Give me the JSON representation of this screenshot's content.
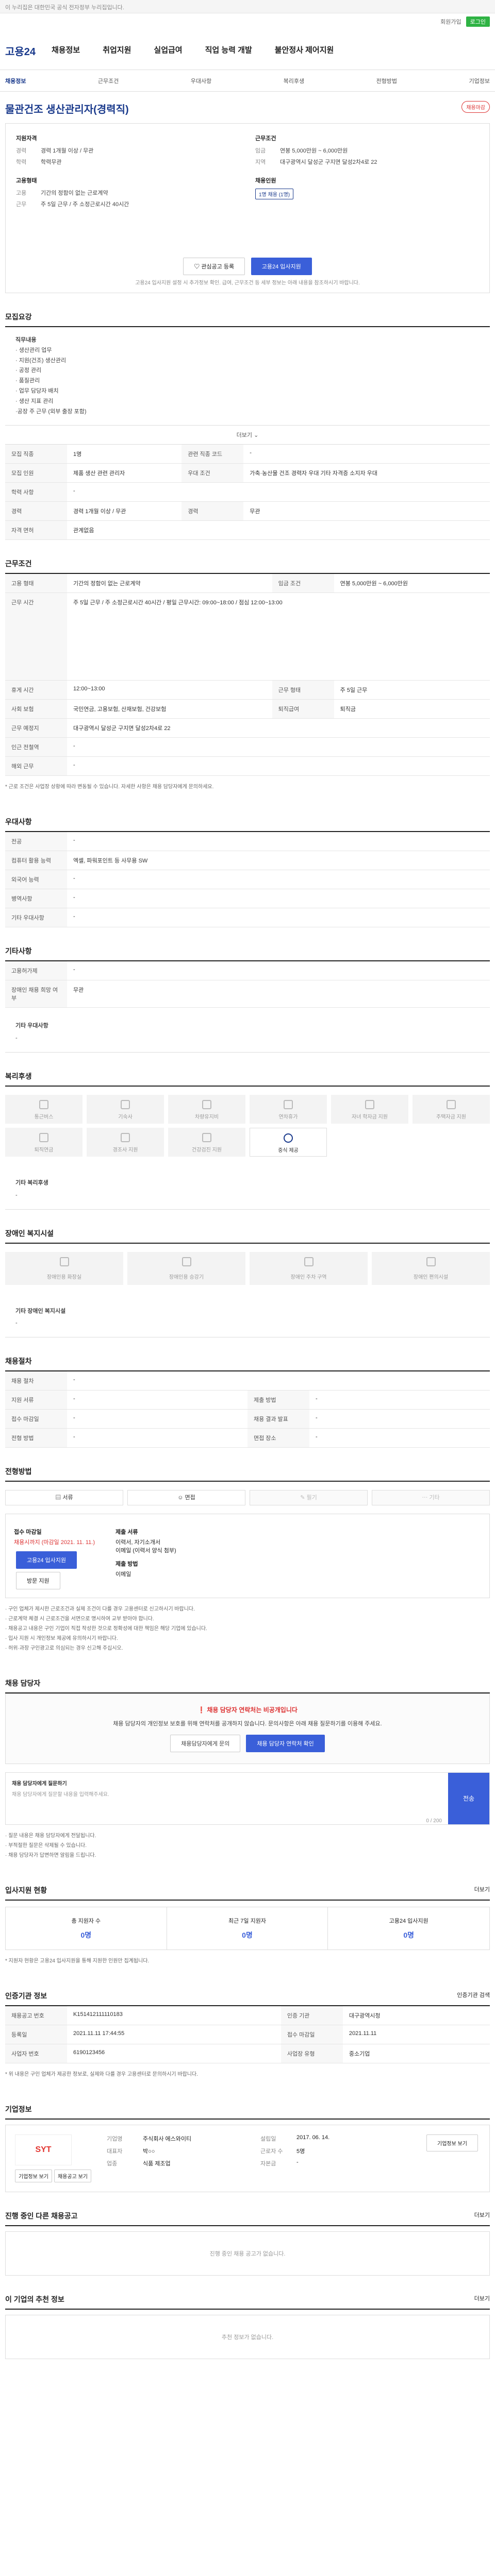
{
  "topbar": {
    "text": "이 누리집은 대한민국 공식 전자정부 누리집입니다."
  },
  "header": {
    "util": [
      "회원가입",
      "로그인"
    ],
    "logo": "고용24",
    "gnb": [
      "채용정보",
      "취업지원",
      "실업급여",
      "직업 능력 개발",
      "불안정사 제어지원"
    ]
  },
  "subnav": [
    "채용정보",
    "근무조건",
    "우대사항",
    "복리후생",
    "전형방법",
    "기업정보"
  ],
  "job": {
    "title": "물관건조 생산관리자(경력직)",
    "badge": "채용마감"
  },
  "summary": {
    "col1_title": "지원자격",
    "col1": [
      [
        "경력",
        "경력 1개월 이상 / 무관"
      ],
      [
        "학력",
        "학력무관"
      ]
    ],
    "col2_title": "근무조건",
    "col2": [
      [
        "임금",
        "연봉 5,000만원 ~ 6,000만원"
      ],
      [
        "지역",
        "대구광역시 달성군 구지면 달성2차4로 22"
      ]
    ],
    "col3_title": "고용형태",
    "col3": [
      [
        "고용",
        "기간의 정함이 없는 근로계약"
      ],
      [
        "근무",
        "주 5일 근무 / 주 소정근로시간 40시간"
      ]
    ],
    "col4_title": "채용인원",
    "col4_tag": "1명 채용 (1명)",
    "btn_favorite": "관심공고 등록",
    "btn_apply": "고용24 입사지원",
    "note": "고용24 입사지원 설정 시 추가정보 확인. 급여, 근무조건 등 세부 정보는 아래 내용을 참조하시기 바랍니다."
  },
  "recruit": {
    "title": "모집요강",
    "desc": [
      "직무내용",
      "· 생산관리 업무",
      "· 지원(건조) 생산관리",
      "· 공정 관리",
      "· 품질관리",
      "· 업무 담당자 배치",
      "· 생산 지표 관리",
      "",
      "·공장 주 근무 (외부 출장 포함)"
    ],
    "more": "더보기",
    "rows": [
      [
        "모집 직종",
        "1명",
        "관련 직종 코드",
        "-"
      ],
      [
        "모집 인원",
        "제품 생산 관련 관리자",
        "우대 조건",
        "가축·농산물 건조 경력자 우대 기타 자격증 소지자 우대"
      ],
      [
        "학력 사항",
        "-",
        "",
        ""
      ],
      [
        "경력",
        "경력 1개월 이상 / 무관",
        "경력",
        "무관"
      ],
      [
        "자격 면허",
        "관계없음",
        "",
        ""
      ]
    ]
  },
  "conditions": {
    "title": "근무조건",
    "rows": [
      [
        "고용 형태",
        "기간의 정함이 없는 근로계약",
        "임금 조건",
        "연봉 5,000만원 ~ 6,000만원"
      ],
      [
        "근무 시간",
        "주 5일 근무 / 주 소정근로시간 40시간 / 평일 근무시간: 09:00~18:00 / 점심 12:00~13:00",
        "",
        ""
      ],
      [
        "휴게 시간",
        "12:00~13:00",
        "근무 형태",
        "주 5일 근무"
      ],
      [
        "사회 보험",
        "국민연금, 고용보험, 산재보험, 건강보험",
        "퇴직급여",
        "퇴직금"
      ],
      [
        "근무 예정지",
        "대구광역시 달성군 구지면 달성2차4로 22",
        "",
        ""
      ],
      [
        "인근 전철역",
        "-",
        "",
        ""
      ],
      [
        "해외 근무",
        "-",
        "",
        ""
      ]
    ],
    "note": "* 근로 조건은 사업장 상황에 따라 변동될 수 있습니다. 자세한 사항은 채용 담당자에게 문의하세요."
  },
  "preferred": {
    "title": "우대사항",
    "rows": [
      [
        "전공",
        "-"
      ],
      [
        "컴퓨터 활용 능력",
        "엑셀, 파워포인트 등 사무용 SW"
      ],
      [
        "외국어 능력",
        "-"
      ],
      [
        "병역사항",
        "-"
      ],
      [
        "기타 우대사항",
        "-"
      ]
    ]
  },
  "extra": {
    "title": "기타사항",
    "rows": [
      [
        "고용허가제",
        "-"
      ],
      [
        "장애인 채용 희망 여부",
        "무관"
      ]
    ],
    "subtitle": "기타 우대사항",
    "subtext": "-"
  },
  "welfare": {
    "title": "복리후생",
    "items": [
      "통근버스",
      "기숙사",
      "차량유지비",
      "연차휴가",
      "자녀 학자금 지원",
      "주택자금 지원",
      "퇴직연금",
      "경조사 지원",
      "건강검진 지원",
      "중식 제공",
      "",
      ""
    ],
    "sub_title": "기타 복리후생",
    "sub_text": "-"
  },
  "accessible": {
    "title": "장애인 복지시설",
    "items": [
      "장애인용 화장실",
      "장애인용 승강기",
      "장애인 주차 구역",
      "장애인 편의시설"
    ],
    "sub_title": "기타 장애인 복지시설",
    "sub_text": "-"
  },
  "process": {
    "title": "채용절차",
    "rows": [
      [
        "채용 절차",
        "-",
        "",
        ""
      ],
      [
        "지원 서류",
        "-",
        "제출 방법",
        "-"
      ],
      [
        "접수 마감일",
        "-",
        "채용 결과 발표",
        "-"
      ],
      [
        "전형 방법",
        "-",
        "면접 장소",
        "-"
      ]
    ]
  },
  "method": {
    "title": "전형방법",
    "items": [
      [
        "서류",
        "on"
      ],
      [
        "면접",
        "on"
      ],
      [
        "필기",
        "off"
      ],
      [
        "기타",
        "off"
      ]
    ]
  },
  "apply": {
    "title": "접수방법",
    "deadline_label": "접수 마감일",
    "deadline": "채용시까지 (마감일 2021. 11. 11.)",
    "btn_apply": "고용24 입사지원",
    "btn_visit": "방문 지원",
    "docs_label": "제출 서류",
    "docs": "이력서, 자기소개서",
    "docs2": "이메일 (이력서 양식 첨부)",
    "method_label": "제출 방법",
    "method": "이메일"
  },
  "warnings": [
    "· 구인 업체가 제시한 근로조건과 실제 조건이 다를 경우 고용센터로 신고하시기 바랍니다.",
    "· 근로계약 체결 시 근로조건을 서면으로 명시하여 교부 받아야 합니다.",
    "· 채용공고 내용은 구인 기업이 직접 작성한 것으로 정확성에 대한 책임은 해당 기업에 있습니다.",
    "· 입사 지원 시 개인정보 제공에 유의하시기 바랍니다.",
    "· 허위·과장 구인광고로 의심되는 경우 신고해 주십시오."
  ],
  "contact": {
    "title": "채용 담당자",
    "alert_title": "채용 담당자 연락처는 비공개입니다",
    "alert_text": "채용 담당자의 개인정보 보호를 위해 연락처를 공개하지 않습니다. 문의사항은 아래 채용 질문하기를 이용해 주세요.",
    "btn_left": "채용담당자에게 문의",
    "btn_right": "채용 담당자 연락처 확인",
    "q_title": "채용 담당자에게 질문하기",
    "q_placeholder": "채용 담당자에게 질문할 내용을 입력해주세요.",
    "q_count": "0 / 200",
    "q_send": "전송",
    "notes": [
      "· 질문 내용은 채용 담당자에게 전달됩니다.",
      "· 부적절한 질문은 삭제될 수 있습니다.",
      "· 채용 담당자가 답변하면 알림을 드립니다."
    ]
  },
  "stats": {
    "title": "입사지원 현황",
    "more": "더보기",
    "items": [
      [
        "총 지원자 수",
        "0명"
      ],
      [
        "최근 7일 지원자",
        "0명"
      ],
      [
        "고용24 입사지원",
        "0명"
      ]
    ],
    "note": "* 지원자 현황은 고용24 입사지원을 통해 지원한 인원만 집계됩니다."
  },
  "info": {
    "title": "인증기관 정보",
    "btn": "인증기관 검색",
    "rows": [
      [
        "채용공고 번호",
        "K151412111110183",
        "인증 기관",
        "대구광역시청"
      ],
      [
        "등록일",
        "2021.11.11 17:44:55",
        "접수 마감일",
        "2021.11.11"
      ],
      [
        "사업자 번호",
        "6190123456",
        "사업장 유형",
        "중소기업"
      ]
    ],
    "note": "* 위 내용은 구인 업체가 제공한 정보로, 실제와 다를 경우 고용센터로 문의하시기 바랍니다."
  },
  "company": {
    "title": "기업정보",
    "logo": "SYT",
    "btn_list": "기업정보 보기",
    "btn_more": "채용공고 보기",
    "fields": [
      [
        "기업명",
        "주식회사 에스와이티"
      ],
      [
        "대표자",
        "박○○"
      ],
      [
        "업종",
        "식품 제조업"
      ],
      [
        "설립일",
        "2017. 06. 14."
      ],
      [
        "근로자 수",
        "5명"
      ],
      [
        "자본금",
        "-"
      ]
    ],
    "btn_view": "기업정보 보기"
  },
  "other_jobs": {
    "title": "진행 중인 다른 채용공고",
    "more": "더보기",
    "empty": "진행 중인 채용 공고가 없습니다."
  },
  "recommend": {
    "title": "이 기업의 추천 정보",
    "more": "더보기",
    "empty": "추천 정보가 없습니다."
  },
  "colors": {
    "primary": "#3a5fd9",
    "brand": "#1a3a8c",
    "alert": "#d33"
  }
}
